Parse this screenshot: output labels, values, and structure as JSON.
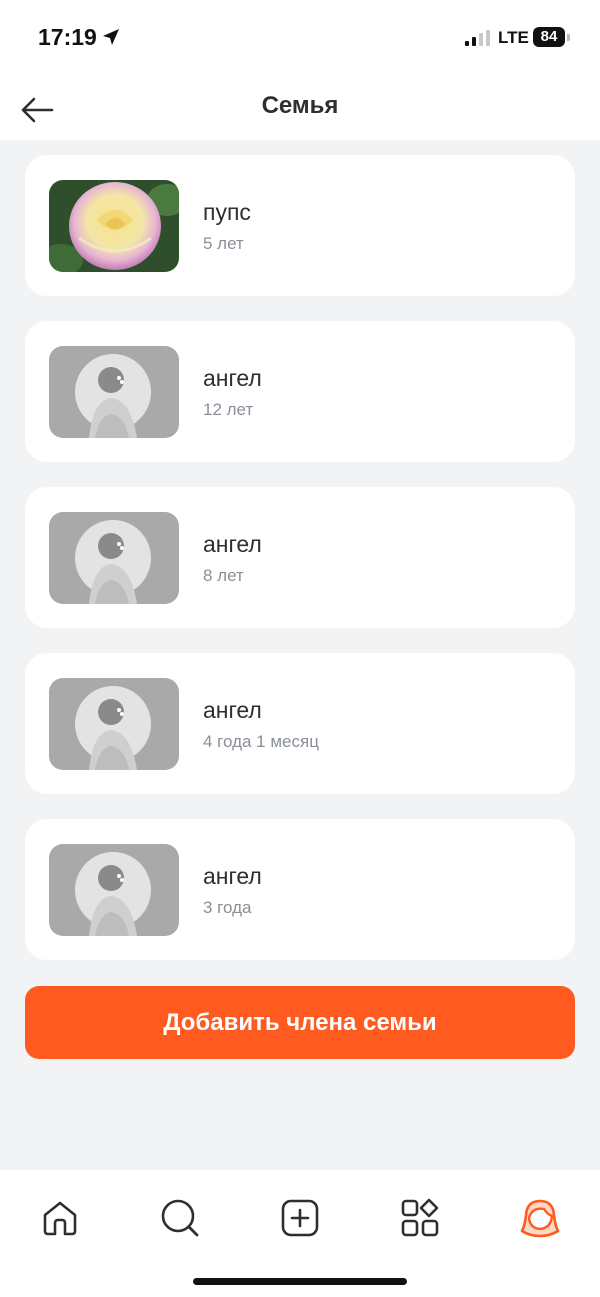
{
  "status_bar": {
    "time": "17:19",
    "network": "LTE",
    "battery": "84"
  },
  "header": {
    "title": "Семья",
    "back_icon": "arrow-left-icon"
  },
  "members": [
    {
      "name": "пупс",
      "age": "5 лет",
      "photo": "rose-photo"
    },
    {
      "name": "ангел",
      "age": "12 лет",
      "photo": "child-photo"
    },
    {
      "name": "ангел",
      "age": "8 лет",
      "photo": "child-photo"
    },
    {
      "name": "ангел",
      "age": "4 года 1 месяц",
      "photo": "child-photo"
    },
    {
      "name": "ангел",
      "age": "3 года",
      "photo": "child-photo"
    }
  ],
  "add_button": {
    "label": "Добавить члена семьи"
  },
  "tab_bar": {
    "tabs": [
      "home-icon",
      "search-icon",
      "add-icon",
      "catalog-icon",
      "profile-icon"
    ],
    "active_tab": "profile-icon"
  },
  "colors": {
    "accent": "#ff5a1f",
    "background": "#f2f3f5",
    "text": "#2d2f33",
    "secondary_text": "#8a8f98"
  }
}
